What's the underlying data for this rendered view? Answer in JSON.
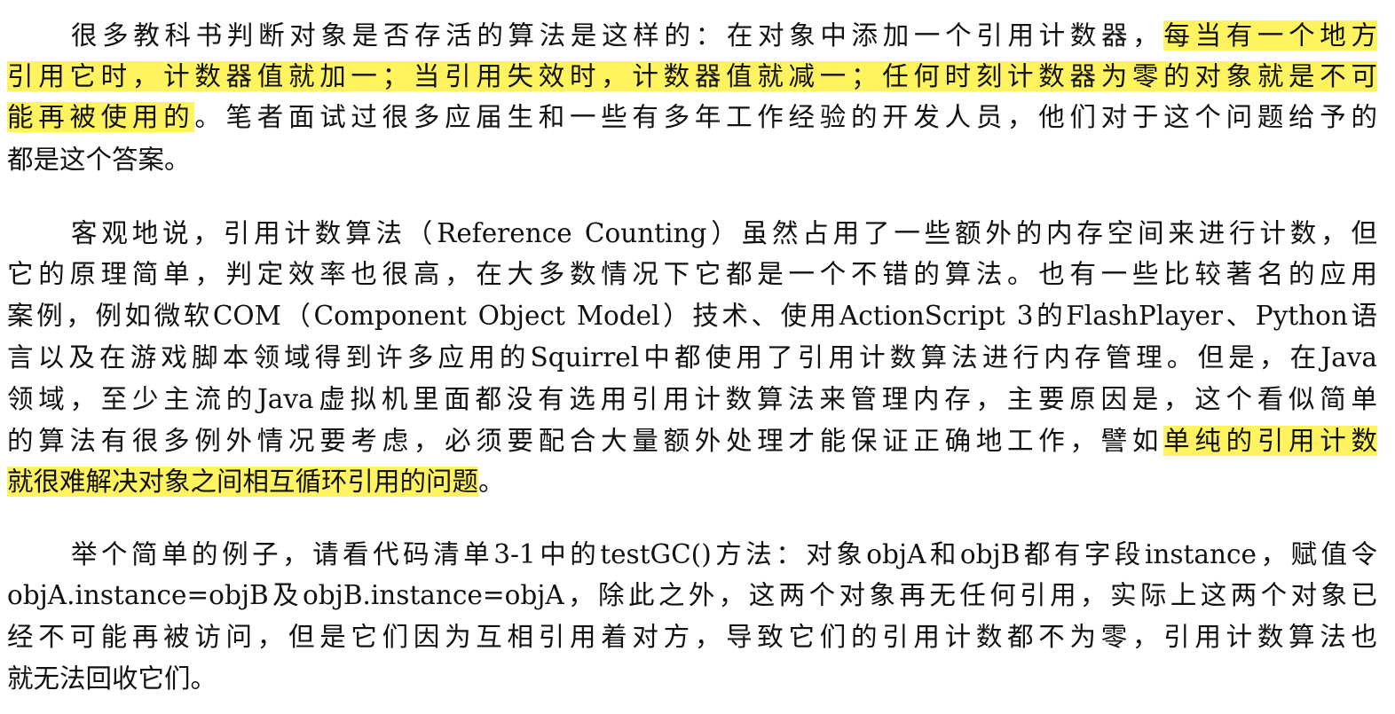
{
  "highlight_color": "#fff460",
  "paragraphs": [
    {
      "lines": [
        {
          "a": "很多教科书判断对象是否存活的算法是这样的：在对象中添加一个引用计数器，",
          "hl": "每当有一个地方",
          "b": ""
        },
        {
          "a": "",
          "hl": "引用它时，计数器值就加一；当引用失效时，计数器值就减一；任何时刻计数器为零的对象就是不可",
          "b": ""
        },
        {
          "a": "",
          "hl": "能再被使用的",
          "b": "。笔者面试过很多应届生和一些有多年工作经验的开发人员，他们对于这个问题给予的"
        },
        {
          "a": "都是这个答案。",
          "hl": "",
          "b": ""
        }
      ]
    },
    {
      "lines": [
        {
          "a": "客观地说，引用计数算法（Reference Counting）虽然占用了一些额外的内存空间来进行计数，但",
          "hl": "",
          "b": ""
        },
        {
          "a": "它的原理简单，判定效率也很高，在大多数情况下它都是一个不错的算法。也有一些比较著名的应用",
          "hl": "",
          "b": ""
        },
        {
          "a": "案例，例如微软COM（Component Object Model）技术、使用ActionScript 3的FlashPlayer、Python语",
          "hl": "",
          "b": ""
        },
        {
          "a": "言以及在游戏脚本领域得到许多应用的Squirrel中都使用了引用计数算法进行内存管理。但是，在Java",
          "hl": "",
          "b": ""
        },
        {
          "a": "领域，至少主流的Java虚拟机里面都没有选用引用计数算法来管理内存，主要原因是，这个看似简单",
          "hl": "",
          "b": ""
        },
        {
          "a": "的算法有很多例外情况要考虑，必须要配合大量额外处理才能保证正确地工作，譬如",
          "hl": "单纯的引用计数",
          "b": ""
        },
        {
          "a": "",
          "hl": "就很难解决对象之间相互循环引用的问题",
          "b": "。"
        }
      ]
    },
    {
      "lines": [
        {
          "a": "举个简单的例子，请看代码清单3-1中的testGC()方法：对象objA和objB都有字段instance，赋值令",
          "hl": "",
          "b": ""
        },
        {
          "a": "objA.instance=objB及objB.instance=objA，除此之外，这两个对象再无任何引用，实际上这两个对象已",
          "hl": "",
          "b": ""
        },
        {
          "a": "经不可能再被访问，但是它们因为互相引用着对方，导致它们的引用计数都不为零，引用计数算法也",
          "hl": "",
          "b": ""
        },
        {
          "a": "就无法回收它们。",
          "hl": "",
          "b": ""
        }
      ]
    }
  ]
}
